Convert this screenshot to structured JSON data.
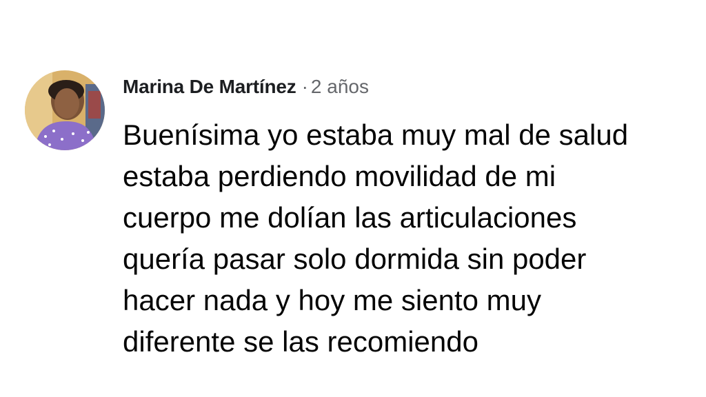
{
  "comment": {
    "author": "Marina De Martínez",
    "separator": "·",
    "timestamp": "2 años",
    "text": "Buenísima yo estaba muy mal de salud\nestaba perdiendo movilidad de mi\ncuerpo me dolían las articulaciones\nquería pasar solo dormida sin poder\nhacer nada y hoy me siento muy\ndiferente se las recomiendo",
    "avatar_icon": "profile-photo"
  },
  "colors": {
    "author": "#1c1e21",
    "meta": "#65676b",
    "text": "#050505",
    "background": "#ffffff"
  }
}
